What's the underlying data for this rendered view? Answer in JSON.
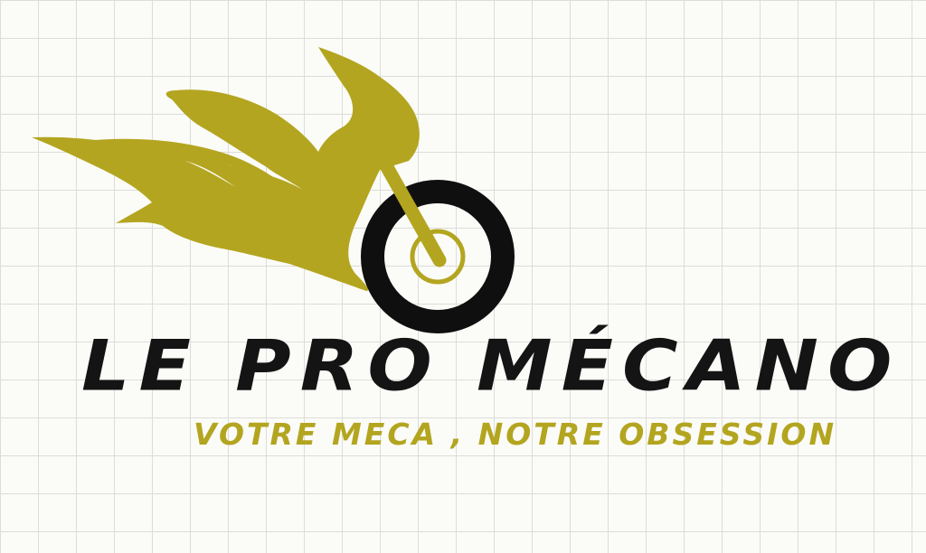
{
  "logo": {
    "brand_name": "LE PRO MÉCANO",
    "tagline": "VOTRE MECA , NOTRE OBSESSION",
    "icon": "flaming-motorcycle-icon"
  },
  "colors": {
    "background": "#fbfbf8",
    "grid_line": "#dcdcd8",
    "flame": "#b3a51f",
    "tire": "#0f0f0f",
    "text_dark": "#141414",
    "text_accent": "#b3a51f"
  }
}
